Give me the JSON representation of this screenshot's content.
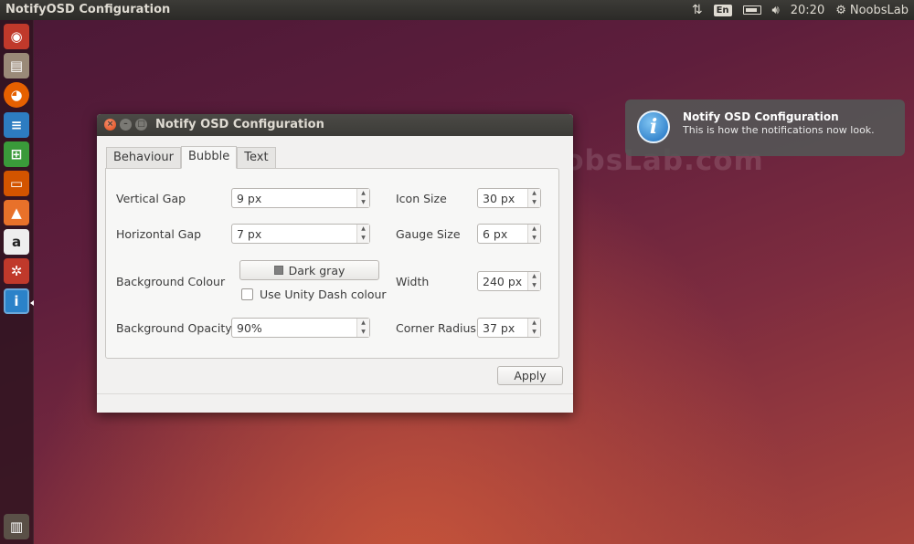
{
  "top_panel": {
    "app_title": "NotifyOSD Configuration",
    "keyboard": "En",
    "clock": "20:20",
    "user": "NoobsLab"
  },
  "launcher": {
    "items": [
      "ubuntu-dash",
      "files",
      "firefox",
      "libreoffice-writer",
      "libreoffice-calc",
      "libreoffice-impress",
      "ubuntu-software-center",
      "amazon",
      "system-settings",
      "notifyosd-config",
      "trash"
    ]
  },
  "watermark": "NoobsLab.com",
  "notification": {
    "title": "Notify OSD Configuration",
    "body": "This is how the notifications now look.",
    "icon": "info-icon"
  },
  "window": {
    "title": "Notify OSD Configuration",
    "tabs": [
      {
        "label": "Behaviour",
        "active": false
      },
      {
        "label": "Bubble",
        "active": true
      },
      {
        "label": "Text",
        "active": false
      }
    ],
    "fields": {
      "vertical_gap": {
        "label": "Vertical Gap",
        "value": "9 px"
      },
      "horizontal_gap": {
        "label": "Horizontal Gap",
        "value": "7 px"
      },
      "background_colour": {
        "label": "Background Colour",
        "value": "Dark gray",
        "swatch": "#808080"
      },
      "use_unity_dash": {
        "label": "Use Unity Dash colour",
        "checked": false
      },
      "background_opacity": {
        "label": "Background Opacity",
        "value": "90%"
      },
      "icon_size": {
        "label": "Icon Size",
        "value": "30 px"
      },
      "gauge_size": {
        "label": "Gauge Size",
        "value": "6 px"
      },
      "width": {
        "label": "Width",
        "value": "240 px"
      },
      "corner_radius": {
        "label": "Corner Radius",
        "value": "37 px"
      }
    },
    "apply_label": "Apply"
  }
}
